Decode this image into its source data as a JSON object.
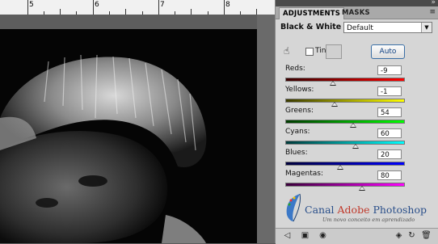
{
  "ruler": {
    "numbers": [
      "5",
      "6",
      "7",
      "8"
    ]
  },
  "panel": {
    "tabs": [
      {
        "label": "ADJUSTMENTS",
        "active": true
      },
      {
        "label": "MASKS",
        "active": false
      }
    ],
    "collapse_icon": "double-chevron-right-icon",
    "menu_icon": "panel-menu-icon",
    "adjustment_title": "Black & White",
    "preset": {
      "selected": "Default"
    },
    "tint": {
      "label": "Tint",
      "checked": false
    },
    "auto_button": "Auto",
    "sliders": [
      {
        "label": "Reds:",
        "value": "-9",
        "fraction": 0.4,
        "gradient": [
          "#3a0000",
          "#ff0000"
        ]
      },
      {
        "label": "Yellows:",
        "value": "-1",
        "fraction": 0.41,
        "gradient": [
          "#3a3a00",
          "#ffff00"
        ]
      },
      {
        "label": "Greens:",
        "value": "54",
        "fraction": 0.57,
        "gradient": [
          "#003a00",
          "#00ff00"
        ]
      },
      {
        "label": "Cyans:",
        "value": "60",
        "fraction": 0.59,
        "gradient": [
          "#003a3a",
          "#00ffff"
        ]
      },
      {
        "label": "Blues:",
        "value": "20",
        "fraction": 0.46,
        "gradient": [
          "#00003a",
          "#0000ff"
        ]
      },
      {
        "label": "Magentas:",
        "value": "80",
        "fraction": 0.64,
        "gradient": [
          "#3a003a",
          "#ff00ff"
        ]
      }
    ]
  },
  "watermark": {
    "canal": "Canal",
    "adobe": "Adobe",
    "photoshop": "Photoshop",
    "slogan": "Um novo conceito em aprendizado"
  },
  "bottom_icons": [
    "back-arrow-icon",
    "clip-layer-icon",
    "visibility-eye-icon",
    "previous-state-icon",
    "reset-icon",
    "trash-icon"
  ],
  "colors": {
    "panel_bg": "#d6d6d6",
    "auto_text": "#0c3e80",
    "brand_blue": "#2a4f8a",
    "brand_red": "#c0392b"
  }
}
